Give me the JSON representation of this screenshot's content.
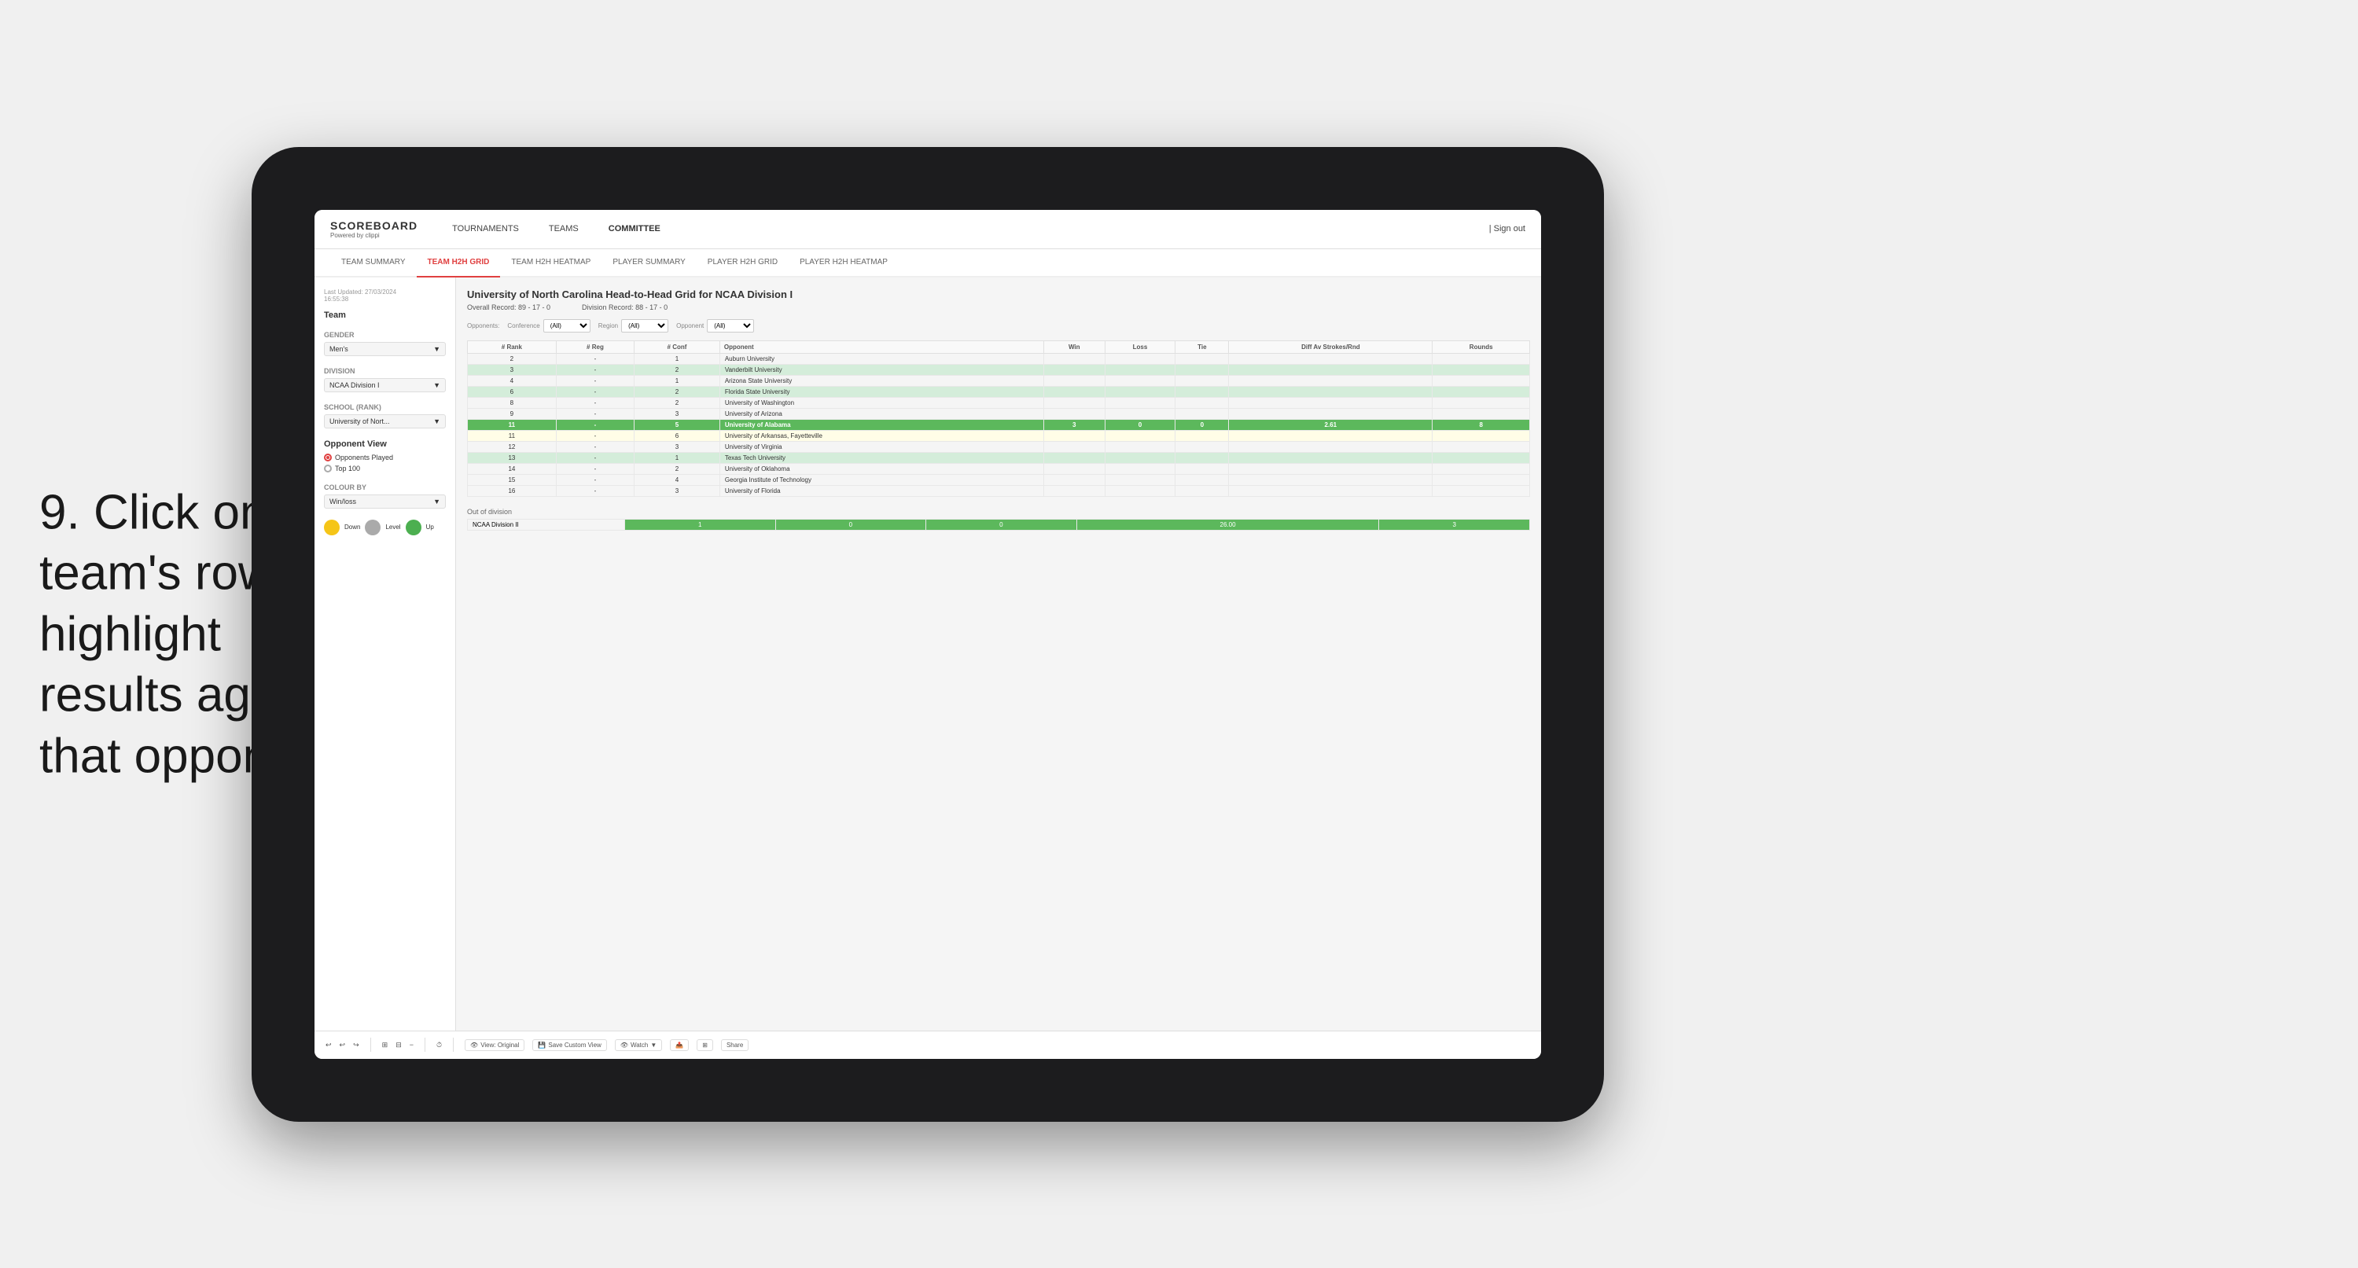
{
  "instruction": {
    "number": "9.",
    "text": "Click on a team's row to highlight results against that opponent"
  },
  "nav": {
    "logo_title": "SCOREBOARD",
    "logo_sub": "Powered by clippi",
    "links": [
      "TOURNAMENTS",
      "TEAMS",
      "COMMITTEE"
    ],
    "sign_out": "Sign out"
  },
  "sub_nav": {
    "items": [
      "TEAM SUMMARY",
      "TEAM H2H GRID",
      "TEAM H2H HEATMAP",
      "PLAYER SUMMARY",
      "PLAYER H2H GRID",
      "PLAYER H2H HEATMAP"
    ],
    "active": "TEAM H2H GRID"
  },
  "left_panel": {
    "last_updated_label": "Last Updated: 27/03/2024",
    "last_updated_time": "16:55:38",
    "team_heading": "Team",
    "gender_label": "Gender",
    "gender_value": "Men's",
    "division_label": "Division",
    "division_value": "NCAA Division I",
    "school_label": "School (Rank)",
    "school_value": "University of Nort...",
    "opponent_view_heading": "Opponent View",
    "opponent_options": [
      "Opponents Played",
      "Top 100"
    ],
    "opponent_selected": "Opponents Played",
    "colour_by_label": "Colour by",
    "colour_by_value": "Win/loss",
    "legend": {
      "down_label": "Down",
      "level_label": "Level",
      "up_label": "Up"
    }
  },
  "grid": {
    "title": "University of North Carolina Head-to-Head Grid for NCAA Division I",
    "overall_record": "Overall Record: 89 - 17 - 0",
    "division_record": "Division Record: 88 - 17 - 0",
    "filters": {
      "opponents_label": "Opponents:",
      "conference_label": "Conference",
      "conference_value": "(All)",
      "region_label": "Region",
      "region_value": "(All)",
      "opponent_label": "Opponent",
      "opponent_value": "(All)"
    },
    "columns": [
      "# Rank",
      "# Reg",
      "# Conf",
      "Opponent",
      "Win",
      "Loss",
      "Tie",
      "Diff Av Strokes/Rnd",
      "Rounds"
    ],
    "rows": [
      {
        "rank": "2",
        "reg": "-",
        "conf": "1",
        "opponent": "Auburn University",
        "win": "",
        "loss": "",
        "tie": "",
        "diff": "",
        "rounds": "",
        "style": ""
      },
      {
        "rank": "3",
        "reg": "-",
        "conf": "2",
        "opponent": "Vanderbilt University",
        "win": "",
        "loss": "",
        "tie": "",
        "diff": "",
        "rounds": "",
        "style": "light-green"
      },
      {
        "rank": "4",
        "reg": "-",
        "conf": "1",
        "opponent": "Arizona State University",
        "win": "",
        "loss": "",
        "tie": "",
        "diff": "",
        "rounds": "",
        "style": ""
      },
      {
        "rank": "6",
        "reg": "-",
        "conf": "2",
        "opponent": "Florida State University",
        "win": "",
        "loss": "",
        "tie": "",
        "diff": "",
        "rounds": "",
        "style": "light-green"
      },
      {
        "rank": "8",
        "reg": "-",
        "conf": "2",
        "opponent": "University of Washington",
        "win": "",
        "loss": "",
        "tie": "",
        "diff": "",
        "rounds": "",
        "style": ""
      },
      {
        "rank": "9",
        "reg": "-",
        "conf": "3",
        "opponent": "University of Arizona",
        "win": "",
        "loss": "",
        "tie": "",
        "diff": "",
        "rounds": "",
        "style": ""
      },
      {
        "rank": "11",
        "reg": "-",
        "conf": "5",
        "opponent": "University of Alabama",
        "win": "3",
        "loss": "0",
        "tie": "0",
        "diff": "2.61",
        "rounds": "8",
        "style": "highlighted"
      },
      {
        "rank": "11",
        "reg": "-",
        "conf": "6",
        "opponent": "University of Arkansas, Fayetteville",
        "win": "",
        "loss": "",
        "tie": "",
        "diff": "",
        "rounds": "",
        "style": "light-yellow"
      },
      {
        "rank": "12",
        "reg": "-",
        "conf": "3",
        "opponent": "University of Virginia",
        "win": "",
        "loss": "",
        "tie": "",
        "diff": "",
        "rounds": "",
        "style": ""
      },
      {
        "rank": "13",
        "reg": "-",
        "conf": "1",
        "opponent": "Texas Tech University",
        "win": "",
        "loss": "",
        "tie": "",
        "diff": "",
        "rounds": "",
        "style": "light-green"
      },
      {
        "rank": "14",
        "reg": "-",
        "conf": "2",
        "opponent": "University of Oklahoma",
        "win": "",
        "loss": "",
        "tie": "",
        "diff": "",
        "rounds": "",
        "style": ""
      },
      {
        "rank": "15",
        "reg": "-",
        "conf": "4",
        "opponent": "Georgia Institute of Technology",
        "win": "",
        "loss": "",
        "tie": "",
        "diff": "",
        "rounds": "",
        "style": ""
      },
      {
        "rank": "16",
        "reg": "-",
        "conf": "3",
        "opponent": "University of Florida",
        "win": "",
        "loss": "",
        "tie": "",
        "diff": "",
        "rounds": "",
        "style": ""
      }
    ],
    "out_of_division": {
      "label": "Out of division",
      "row": {
        "division": "NCAA Division II",
        "win": "1",
        "loss": "0",
        "tie": "0",
        "diff": "26.00",
        "rounds": "3"
      }
    }
  },
  "toolbar": {
    "view_label": "View: Original",
    "save_label": "Save Custom View",
    "watch_label": "Watch",
    "share_label": "Share"
  }
}
